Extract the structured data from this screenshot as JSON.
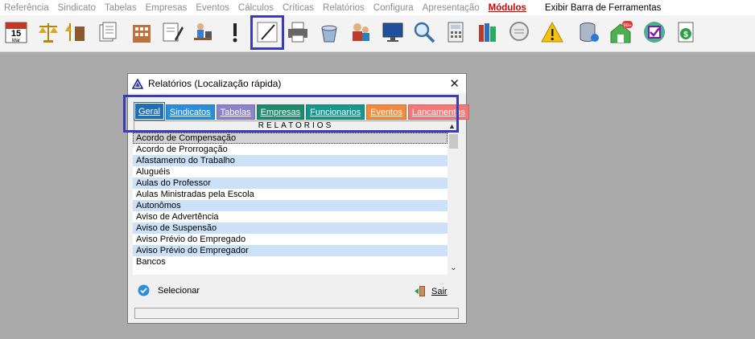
{
  "menu": {
    "items": [
      "Referência",
      "Sindicato",
      "Tabelas",
      "Empresas",
      "Eventos",
      "Cálculos",
      "Críticas",
      "Relatórios",
      "Configura",
      "Apresentação"
    ],
    "modulos": "Módulos",
    "exibir": "Exibir Barra de Ferramentas"
  },
  "toolbar": {
    "calendar_day": "15",
    "calendar_month": "Mar",
    "badge": "99+"
  },
  "dialog": {
    "title": "Relatórios (Localização rápida)",
    "close": "✕",
    "tabs": [
      {
        "label": "Geral",
        "bg": "#1f6fb2",
        "fg": "#ffffff"
      },
      {
        "label": "Sindicatos",
        "bg": "#2b8fd8",
        "fg": "#ffffff"
      },
      {
        "label": "Tabelas",
        "bg": "#8c84c8",
        "fg": "#ffffff"
      },
      {
        "label": "Empresas",
        "bg": "#1f8a6c",
        "fg": "#ffffff"
      },
      {
        "label": "Funcionarios",
        "bg": "#15968e",
        "fg": "#ffffff"
      },
      {
        "label": "Eventos",
        "bg": "#f08a3c",
        "fg": "#ffffff"
      },
      {
        "label": "Lancamentos",
        "bg": "#f07878",
        "fg": "#ffffff"
      }
    ],
    "header": "RELATORIOS",
    "rows": [
      "Acordo de Compensação",
      "Acordo de Prorrogação",
      "Afastamento do Trabalho",
      "Aluguéis",
      "Aulas do Professor",
      "Aulas Ministradas pela Escola",
      "Autonômos",
      "Aviso de Advertência",
      "Aviso de Suspensão",
      "Aviso Prévio do Empregado",
      "Aviso Prévio do Empregador",
      "Bancos"
    ],
    "select_label": "Selecionar",
    "exit_label": "Sair"
  },
  "colors": {
    "highlight": "#3b3bb8",
    "row_alt": "#cce0f7",
    "desktop": "#aaaaaa"
  }
}
